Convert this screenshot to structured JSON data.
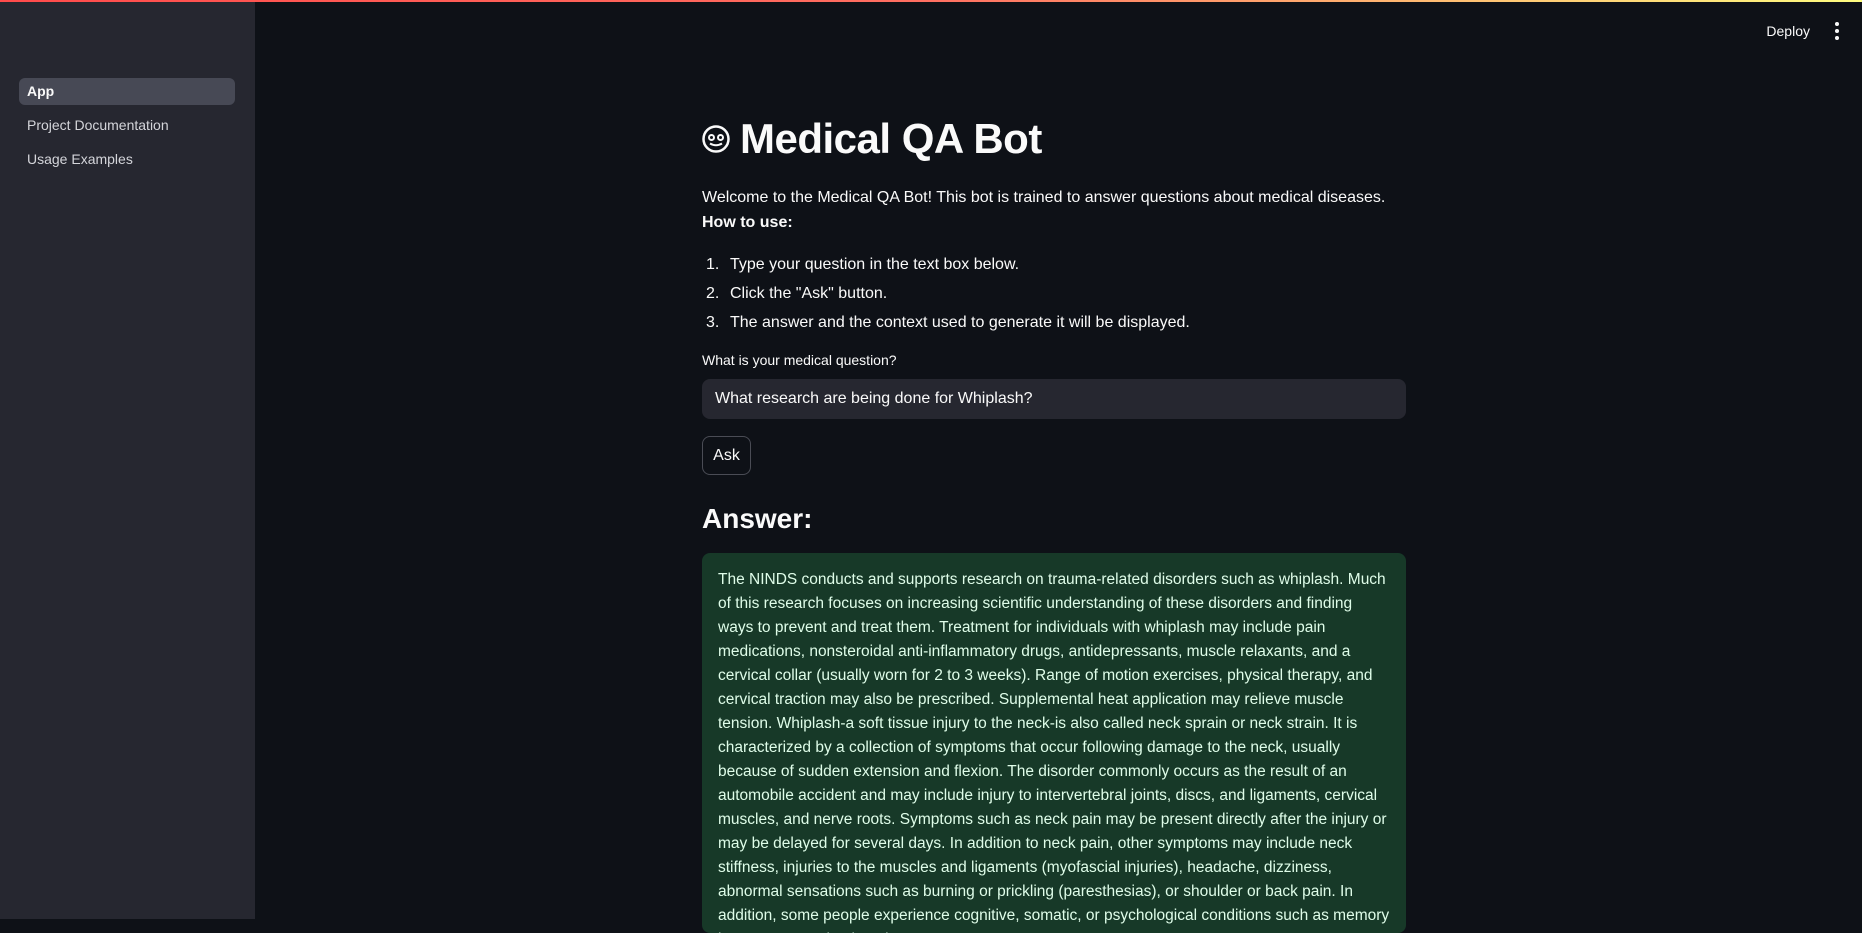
{
  "app": {
    "title": "Medical QA Bot",
    "header": {
      "deploy_label": "Deploy",
      "menu_icon": "kebab-menu-icon"
    }
  },
  "sidebar": {
    "items": [
      {
        "label": "App",
        "active": true
      },
      {
        "label": "Project Documentation",
        "active": false
      },
      {
        "label": "Usage Examples",
        "active": false
      }
    ]
  },
  "main": {
    "title_icon": "bot-face-icon",
    "title": "Medical QA Bot",
    "intro_text": "Welcome to the Medical QA Bot! This bot is trained to answer questions about medical diseases. ",
    "intro_bold": "How to use:",
    "steps": [
      {
        "num": "1.",
        "text": "Type your question in the text box below."
      },
      {
        "num": "2.",
        "text": "Click the \"Ask\" button."
      },
      {
        "num": "3.",
        "text": "The answer and the context used to generate it will be displayed."
      }
    ],
    "question_label": "What is your medical question?",
    "question_value": "What research are being done for Whiplash?",
    "ask_label": "Ask",
    "answer_heading": "Answer:",
    "answer_text": "The NINDS conducts and supports research on trauma-related disorders such as whiplash. Much of this research focuses on increasing scientific understanding of these disorders and finding ways to prevent and treat them. Treatment for individuals with whiplash may include pain medications, nonsteroidal anti-inflammatory drugs, antidepressants, muscle relaxants, and a cervical collar (usually worn for 2 to 3 weeks). Range of motion exercises, physical therapy, and cervical traction may also be prescribed. Supplemental heat application may relieve muscle tension. Whiplash-a soft tissue injury to the neck-is also called neck sprain or neck strain. It is characterized by a collection of symptoms that occur following damage to the neck, usually because of sudden extension and flexion. The disorder commonly occurs as the result of an automobile accident and may include injury to intervertebral joints, discs, and ligaments, cervical muscles, and nerve roots. Symptoms such as neck pain may be present directly after the injury or may be delayed for several days. In addition to neck pain, other symptoms may include neck stiffness, injuries to the muscles and ligaments (myofascial injuries), headache, dizziness, abnormal sensations such as burning or prickling (paresthesias), or shoulder or back pain. In addition, some people experience cognitive, somatic, or psychological conditions such as memory loss, concentration impairment"
  },
  "colors": {
    "background": "#0e1117",
    "sidebar": "#262730",
    "answer_bg": "#173928",
    "answer_text": "#dffde9"
  }
}
